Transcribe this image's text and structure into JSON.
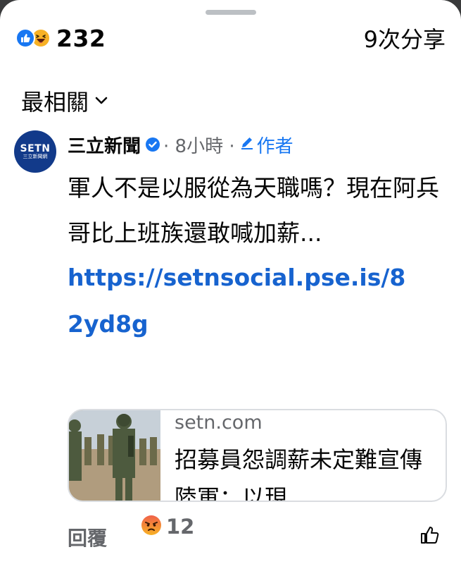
{
  "stats": {
    "reaction_count": "232",
    "share_text": "9次分享"
  },
  "sort": {
    "label": "最相關"
  },
  "comment": {
    "avatar_text": "SETN",
    "avatar_subtext": "三立新聞網",
    "author": "三立新聞",
    "time": "· 8小時 ·",
    "author_badge": "作者",
    "text": "軍人不是以服從為天職嗎？現在阿兵哥比上班族還敢喊加薪...",
    "link": "https://setnsocial.pse.is/82yd8g",
    "preview": {
      "domain": "setn.com",
      "title": "招募員怨調薪未定難宣傳　陸軍：以現"
    },
    "actions": {
      "reply": "回覆",
      "reaction_count": "12"
    }
  },
  "colors": {
    "link_blue": "#1763cf",
    "brand_blue": "#1877f2",
    "secondary_text": "#65676b"
  }
}
